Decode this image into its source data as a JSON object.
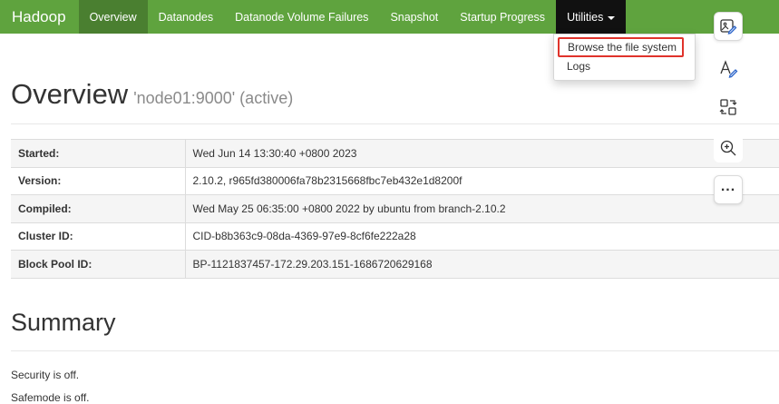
{
  "navbar": {
    "brand": "Hadoop",
    "items": [
      {
        "label": "Overview"
      },
      {
        "label": "Datanodes"
      },
      {
        "label": "Datanode Volume Failures"
      },
      {
        "label": "Snapshot"
      },
      {
        "label": "Startup Progress"
      },
      {
        "label": "Utilities"
      }
    ]
  },
  "dropdown": {
    "items": [
      {
        "label": "Browse the file system"
      },
      {
        "label": "Logs"
      }
    ]
  },
  "overview": {
    "title": "Overview",
    "subtitle": "'node01:9000' (active)",
    "rows": [
      {
        "key": "Started:",
        "value": "Wed Jun 14 13:30:40 +0800 2023"
      },
      {
        "key": "Version:",
        "value": "2.10.2, r965fd380006fa78b2315668fbc7eb432e1d8200f"
      },
      {
        "key": "Compiled:",
        "value": "Wed May 25 06:35:00 +0800 2022 by ubuntu from branch-2.10.2"
      },
      {
        "key": "Cluster ID:",
        "value": "CID-b8b363c9-08da-4369-97e9-8cf6fe222a28"
      },
      {
        "key": "Block Pool ID:",
        "value": "BP-1121837457-172.29.203.151-1686720629168"
      }
    ]
  },
  "summary": {
    "title": "Summary",
    "lines": [
      "Security is off.",
      "Safemode is off."
    ]
  },
  "side_toolbar": {
    "icons": [
      "image-edit-icon",
      "text-edit-icon",
      "translate-icon",
      "zoom-in-icon",
      "more-icon"
    ],
    "more_label": "...",
    "accent": "#333333"
  },
  "colors": {
    "navbar": "#5fa33e",
    "navbar_active": "#4a7f30",
    "navbar_open": "#111111",
    "highlight_border": "#e0332b"
  }
}
